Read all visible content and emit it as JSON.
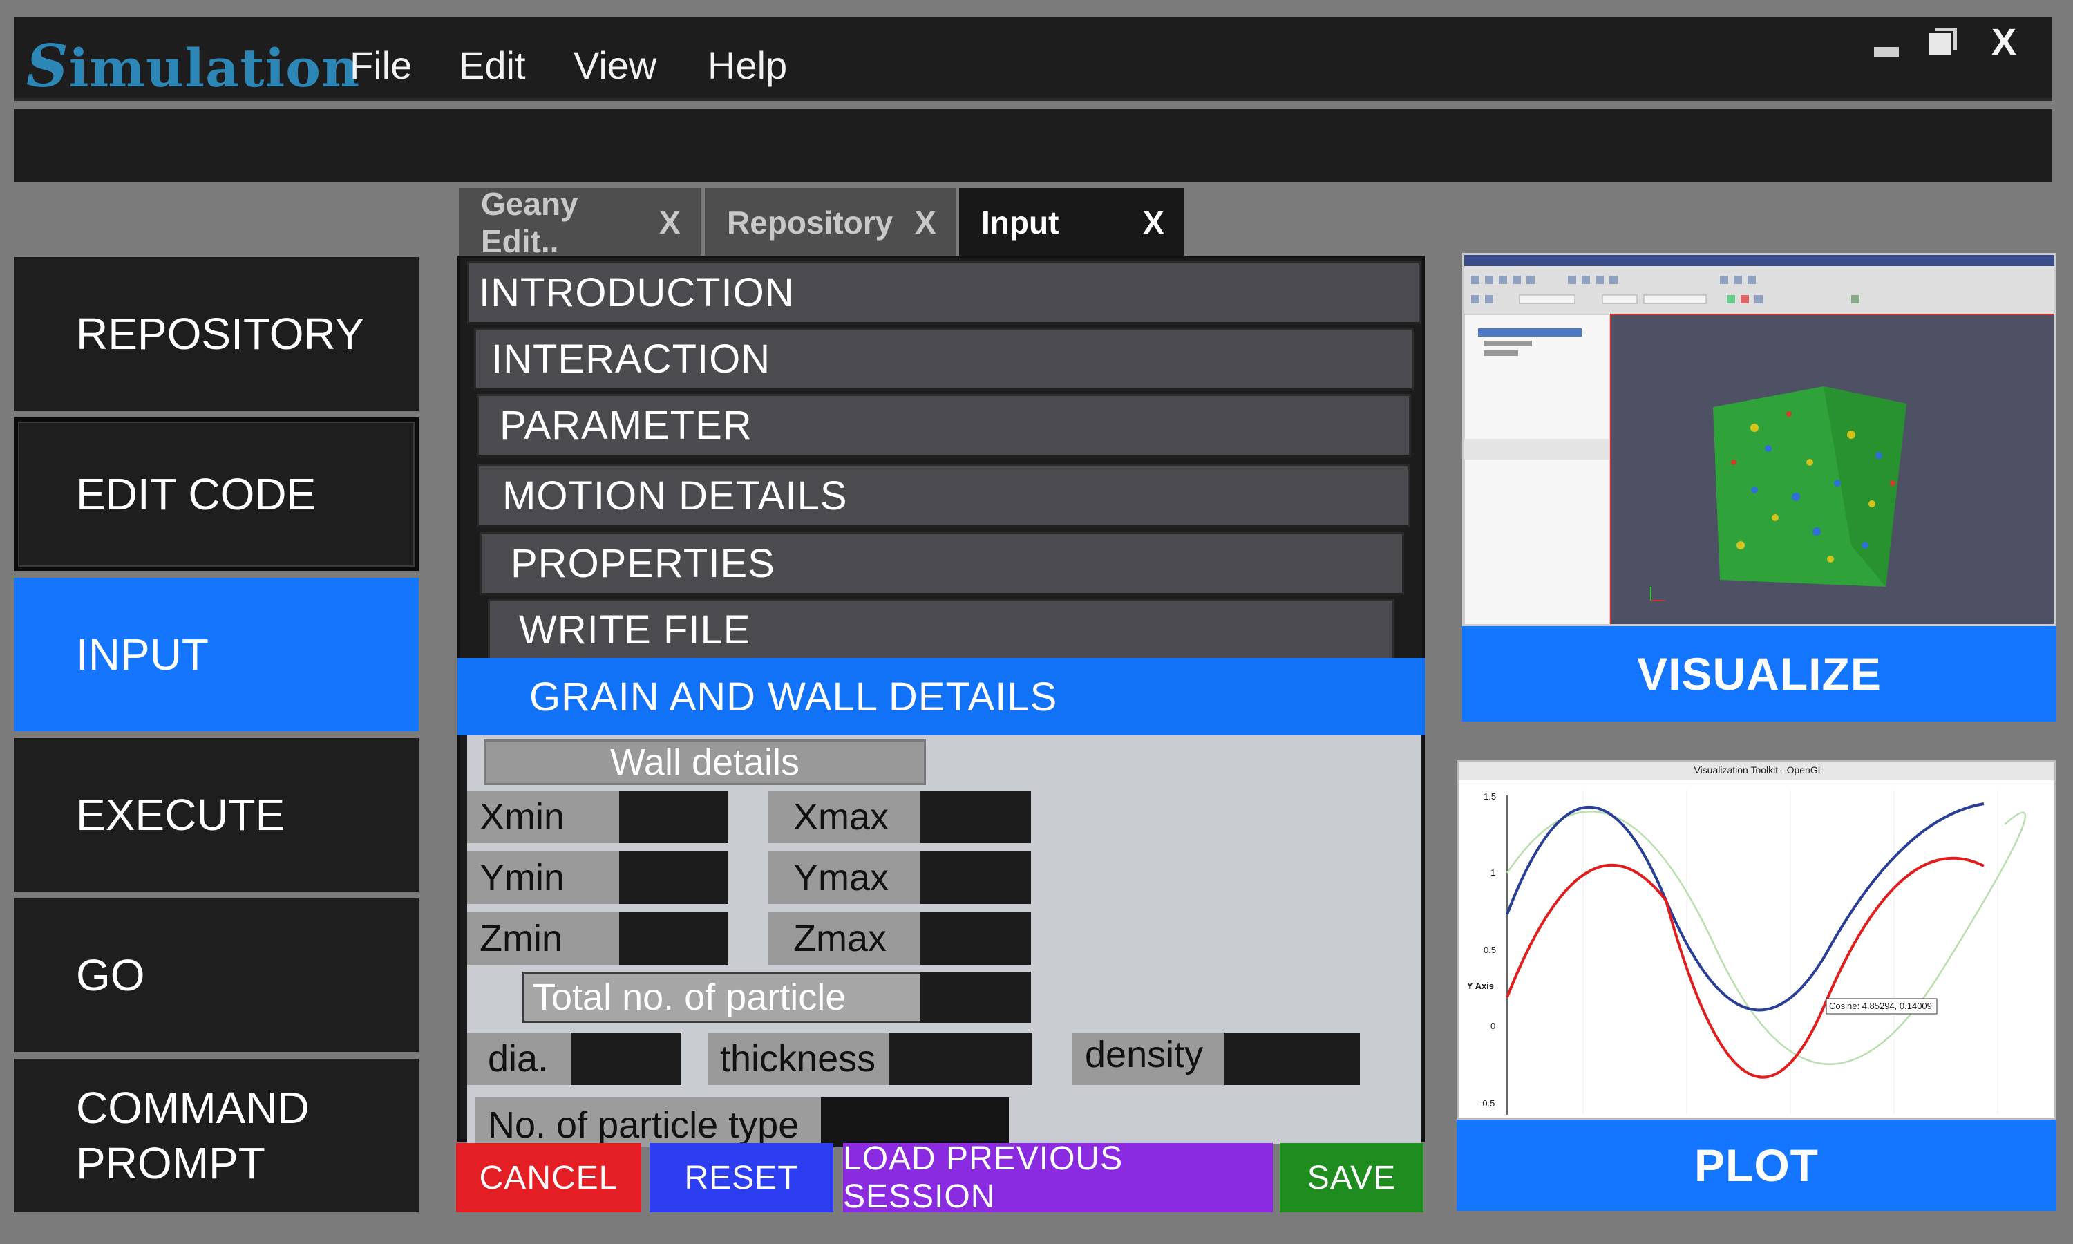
{
  "app": {
    "logo_initial": "S",
    "logo_rest": "imulation",
    "menu": [
      "File",
      "Edit",
      "View",
      "Help"
    ],
    "close_label": "X"
  },
  "sidebar": {
    "items": [
      {
        "label": "REPOSITORY"
      },
      {
        "label": "EDIT CODE"
      },
      {
        "label": "INPUT"
      },
      {
        "label": "EXECUTE"
      },
      {
        "label": "GO"
      },
      {
        "label": "COMMAND\nPROMPT"
      }
    ],
    "active_index": 2
  },
  "tabs": [
    {
      "label": "Geany Edit..",
      "close": "X"
    },
    {
      "label": "Repository",
      "close": "X"
    },
    {
      "label": "Input",
      "close": "X"
    }
  ],
  "sections": [
    "INTRODUCTION",
    "INTERACTION",
    "PARAMETER",
    "MOTION DETAILS",
    "PROPERTIES",
    "WRITE FILE",
    "GRAIN AND WALL DETAILS"
  ],
  "form": {
    "wall_header": "Wall details",
    "xmin": "Xmin",
    "xmax": "Xmax",
    "ymin": "Ymin",
    "ymax": "Ymax",
    "zmin": "Zmin",
    "zmax": "Zmax",
    "total_particle": "Total no. of particle",
    "dia": "dia.",
    "thickness": "thickness",
    "density": "density",
    "particle_type": "No. of particle type"
  },
  "buttons": {
    "cancel": "CANCEL",
    "reset": "RESET",
    "load": "LOAD PREVIOUS SESSION",
    "save": "SAVE"
  },
  "right": {
    "visualize": "VISUALIZE",
    "plot": "PLOT",
    "plot_window_title": "Visualization Toolkit - OpenGL",
    "plot_ylabel": "Y Axis",
    "plot_yticks": [
      "1.5",
      "1",
      "0.5",
      "0",
      "-0.5"
    ],
    "plot_tooltip": "Cosine: 4.85294, 0.14009"
  },
  "colors": {
    "accent": "#1475fe",
    "cancel": "#e31e24",
    "reset": "#2d3ef0",
    "load": "#8a2be2",
    "save": "#1e8c1e"
  }
}
